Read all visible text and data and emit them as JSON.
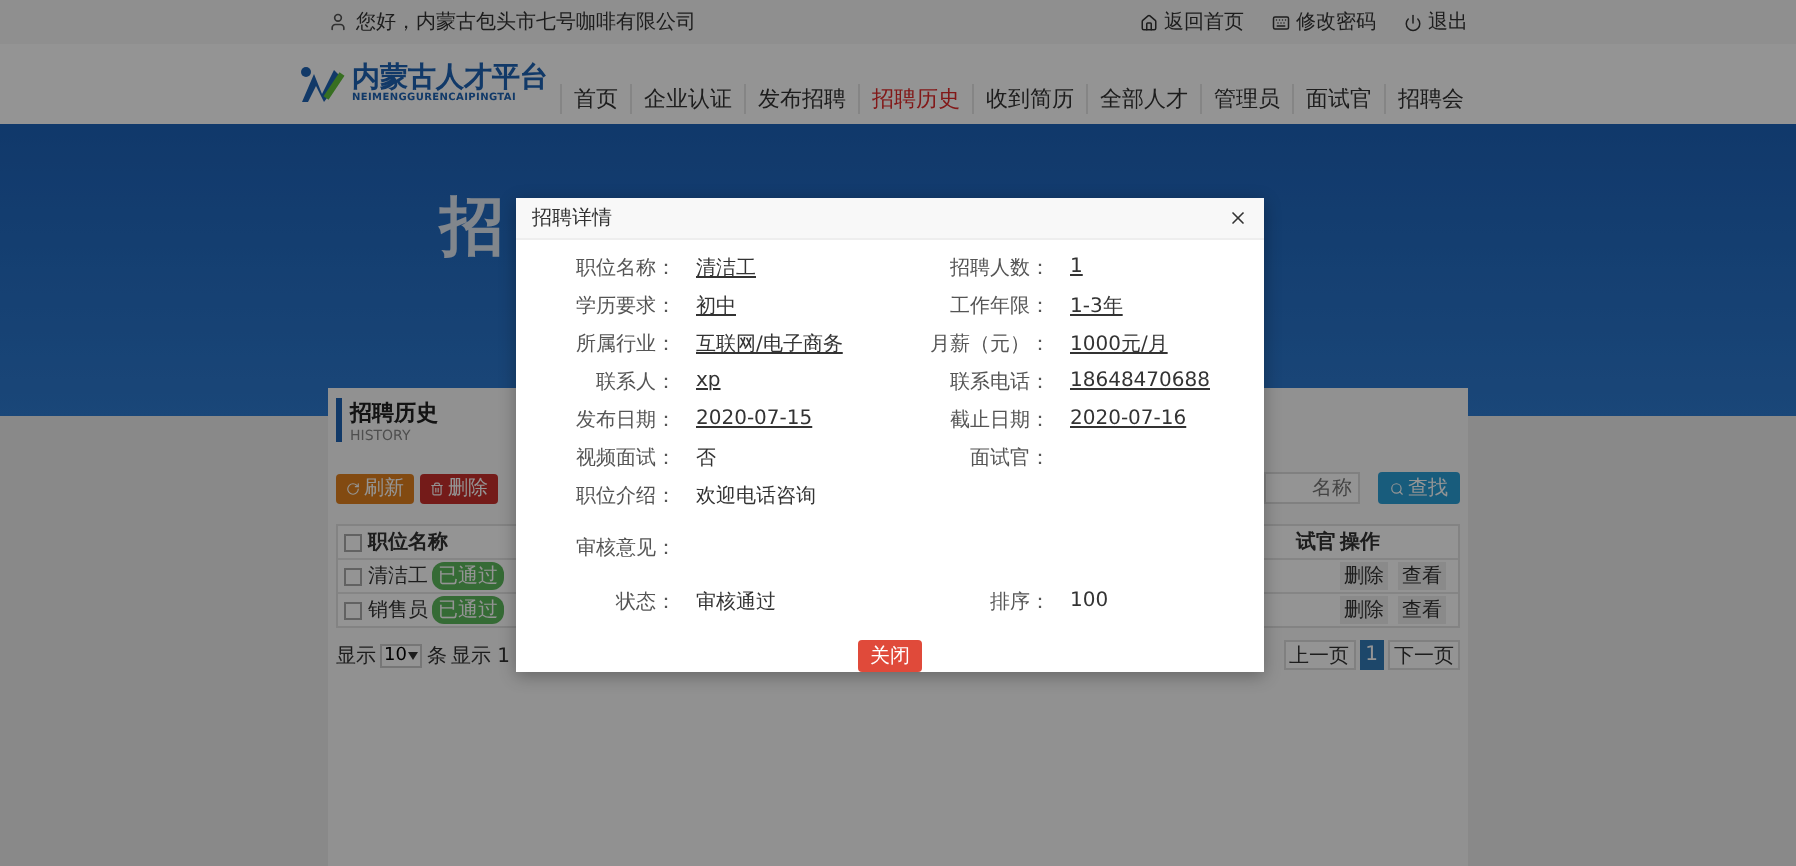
{
  "top_bar": {
    "greeting": "您好，内蒙古包头市七号咖啡有限公司",
    "links": [
      {
        "kind": "home",
        "label": "返回首页"
      },
      {
        "kind": "password",
        "label": "修改密码"
      },
      {
        "kind": "logout",
        "label": "退出"
      }
    ]
  },
  "logo": {
    "name": "内蒙古人才平台",
    "pinyin": "NEIMENGGURENCAIPINGTAI"
  },
  "nav": [
    {
      "label": "首页",
      "selected": false
    },
    {
      "label": "企业认证",
      "selected": false
    },
    {
      "label": "发布招聘",
      "selected": false
    },
    {
      "label": "招聘历史",
      "selected": true
    },
    {
      "label": "收到简历",
      "selected": false
    },
    {
      "label": "全部人才",
      "selected": false
    },
    {
      "label": "管理员",
      "selected": false
    },
    {
      "label": "面试官",
      "selected": false
    },
    {
      "label": "招聘会",
      "selected": false
    }
  ],
  "banner": {
    "title": "招"
  },
  "section": {
    "title": "招聘历史",
    "subtitle": "HISTORY"
  },
  "toolbar": {
    "buttons": [
      {
        "kind": "refresh",
        "label": "刷新"
      },
      {
        "kind": "delete",
        "label": "删除"
      }
    ],
    "search_placeholder": "名称",
    "search_button": "查找"
  },
  "table": {
    "header_checked": false,
    "left_columns": [
      "职位名称"
    ],
    "right_columns": [
      "试官",
      "操作"
    ],
    "rows": [
      {
        "checked": false,
        "name": "清洁工",
        "status": "已通过",
        "actions": [
          "删除",
          "查看"
        ]
      },
      {
        "checked": false,
        "name": "销售员",
        "status": "已通过",
        "actions": [
          "删除",
          "查看"
        ]
      }
    ]
  },
  "footer": {
    "show": "显示",
    "page_size": "10",
    "unit": "条",
    "summary": "显示 1",
    "prev": "上一页",
    "pages": [
      {
        "label": "1",
        "selected": true
      }
    ],
    "next": "下一页"
  },
  "modal": {
    "title": "招聘详情",
    "close_button": "关闭",
    "rows": [
      {
        "tall": false,
        "fields": [
          {
            "label": "职位名称：",
            "value": "清洁工",
            "underlined": true
          },
          {
            "label": "招聘人数：",
            "value": "1",
            "underlined": true
          }
        ]
      },
      {
        "tall": false,
        "fields": [
          {
            "label": "学历要求：",
            "value": "初中",
            "underlined": true
          },
          {
            "label": "工作年限：",
            "value": "1-3年",
            "underlined": true
          }
        ]
      },
      {
        "tall": false,
        "fields": [
          {
            "label": "所属行业：",
            "value": "互联网/电子商务",
            "underlined": true
          },
          {
            "label": "月薪（元）：",
            "value": "1000元/月",
            "underlined": true
          }
        ]
      },
      {
        "tall": false,
        "fields": [
          {
            "label": "联系人：",
            "value": "xp",
            "underlined": true
          },
          {
            "label": "联系电话：",
            "value": "18648470688",
            "underlined": true
          }
        ]
      },
      {
        "tall": false,
        "fields": [
          {
            "label": "发布日期：",
            "value": "2020-07-15",
            "underlined": true
          },
          {
            "label": "截止日期：",
            "value": "2020-07-16",
            "underlined": true
          }
        ]
      },
      {
        "tall": false,
        "fields": [
          {
            "label": "视频面试：",
            "value": "否",
            "underlined": false
          },
          {
            "label": "面试官："
          }
        ]
      },
      {
        "tall": false,
        "fields": [
          {
            "label": "职位介绍：",
            "value": "欢迎电话咨询",
            "underlined": false
          }
        ]
      },
      {
        "tall": true,
        "fields": [
          {
            "label": "审核意见："
          }
        ]
      },
      {
        "tall": false,
        "fields": [
          {
            "label": "状态：",
            "value": "审核通过",
            "underlined": false
          },
          {
            "label": "排序：",
            "value": "100",
            "underlined": false
          }
        ]
      }
    ]
  }
}
